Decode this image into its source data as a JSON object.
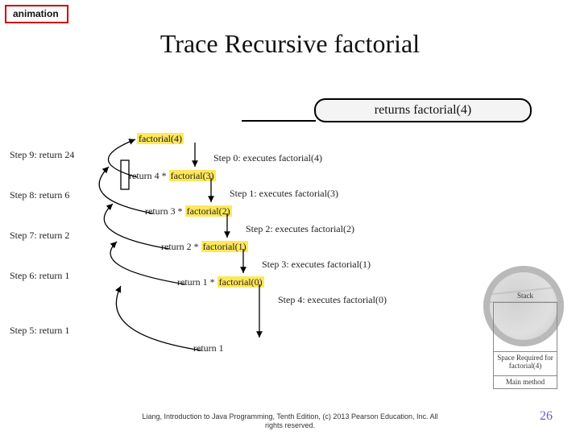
{
  "tag": "animation",
  "title": "Trace Recursive factorial",
  "callout": "returns factorial(4)",
  "top_call": "factorial(4)",
  "down_steps": [
    "Step 0: executes factorial(4)",
    "Step 1: executes factorial(3)",
    "Step 2: executes factorial(2)",
    "Step 3: executes factorial(1)",
    "Step 4: executes factorial(0)"
  ],
  "up_steps": [
    "Step 9: return 24",
    "Step 8: return 6",
    "Step 7: return 2",
    "Step 6: return 1",
    "Step 5: return 1"
  ],
  "returns": [
    {
      "prefix": "return 4 * ",
      "call": "factorial(3)"
    },
    {
      "prefix": "return 3 * ",
      "call": "factorial(2)"
    },
    {
      "prefix": "return 2 * ",
      "call": "factorial(1)"
    },
    {
      "prefix": "return 1 * ",
      "call": "factorial(0)"
    },
    {
      "prefix": "return 1",
      "call": ""
    }
  ],
  "stack": {
    "title": "Stack",
    "rows": [
      "Space Required for factorial(4)",
      "Main method"
    ]
  },
  "footer_l1": "Liang, Introduction to Java Programming, Tenth Edition, (c) 2013 Pearson Education, Inc. All",
  "footer_l2": "rights reserved.",
  "page": "26"
}
